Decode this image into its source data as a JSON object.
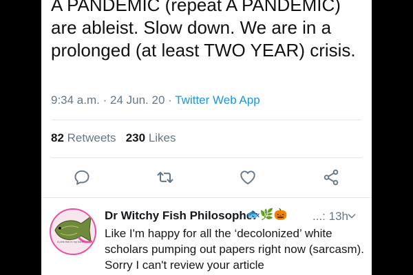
{
  "tweet": {
    "text": "A PANDEMIC (repeat A PANDEMIC) are ableist. Slow down. We are in a prolonged (at least TWO YEAR) crisis.",
    "time": "9:34 a.m.",
    "date": "24 Jun. 20",
    "source": "Twitter Web App",
    "retweet_count": "82",
    "retweet_label": "Retweets",
    "like_count": "230",
    "like_label": "Likes",
    "actions": [
      "reply-icon",
      "retweet-icon",
      "like-icon",
      "share-icon"
    ]
  },
  "reply": {
    "name": "Dr Witchy Fish Philosopher",
    "name_emoji": "🐟🌿🎃",
    "time": "...: 13h",
    "text": "Like I'm happy for all the ‘decolonized’ white scholars pumping out papers right now (sarcasm). Sorry I can't review your article",
    "avatar_caption": "A pink fish in my hand"
  },
  "colors": {
    "background": "#000000",
    "card": "#ffffff",
    "link": "#1b95e0",
    "muted": "#657786",
    "text": "#14171a"
  }
}
